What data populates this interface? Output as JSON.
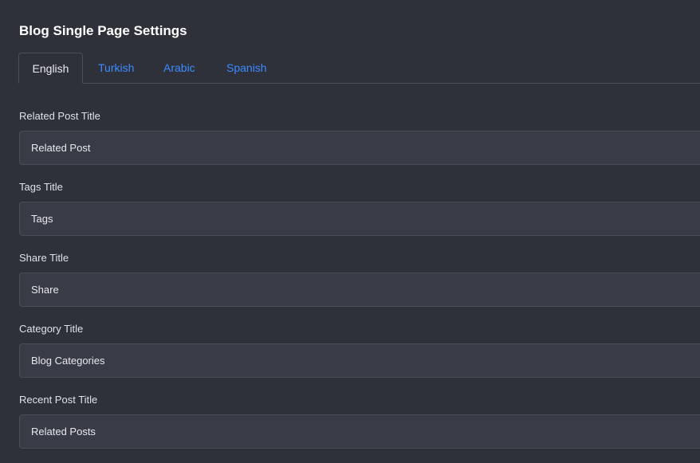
{
  "page": {
    "title": "Blog Single Page Settings"
  },
  "tabs": [
    {
      "label": "English",
      "active": true
    },
    {
      "label": "Turkish",
      "active": false
    },
    {
      "label": "Arabic",
      "active": false
    },
    {
      "label": "Spanish",
      "active": false
    }
  ],
  "fields": {
    "related_post": {
      "label": "Related Post Title",
      "value": "Related Post"
    },
    "tags": {
      "label": "Tags Title",
      "value": "Tags"
    },
    "share": {
      "label": "Share Title",
      "value": "Share"
    },
    "category": {
      "label": "Category Title",
      "value": "Blog Categories"
    },
    "recent_post": {
      "label": "Recent Post Title",
      "value": "Related Posts"
    }
  },
  "colors": {
    "background": "#2d3039",
    "input_background": "#393c47",
    "tab_link": "#3d8bff",
    "border": "#4a4e58"
  }
}
